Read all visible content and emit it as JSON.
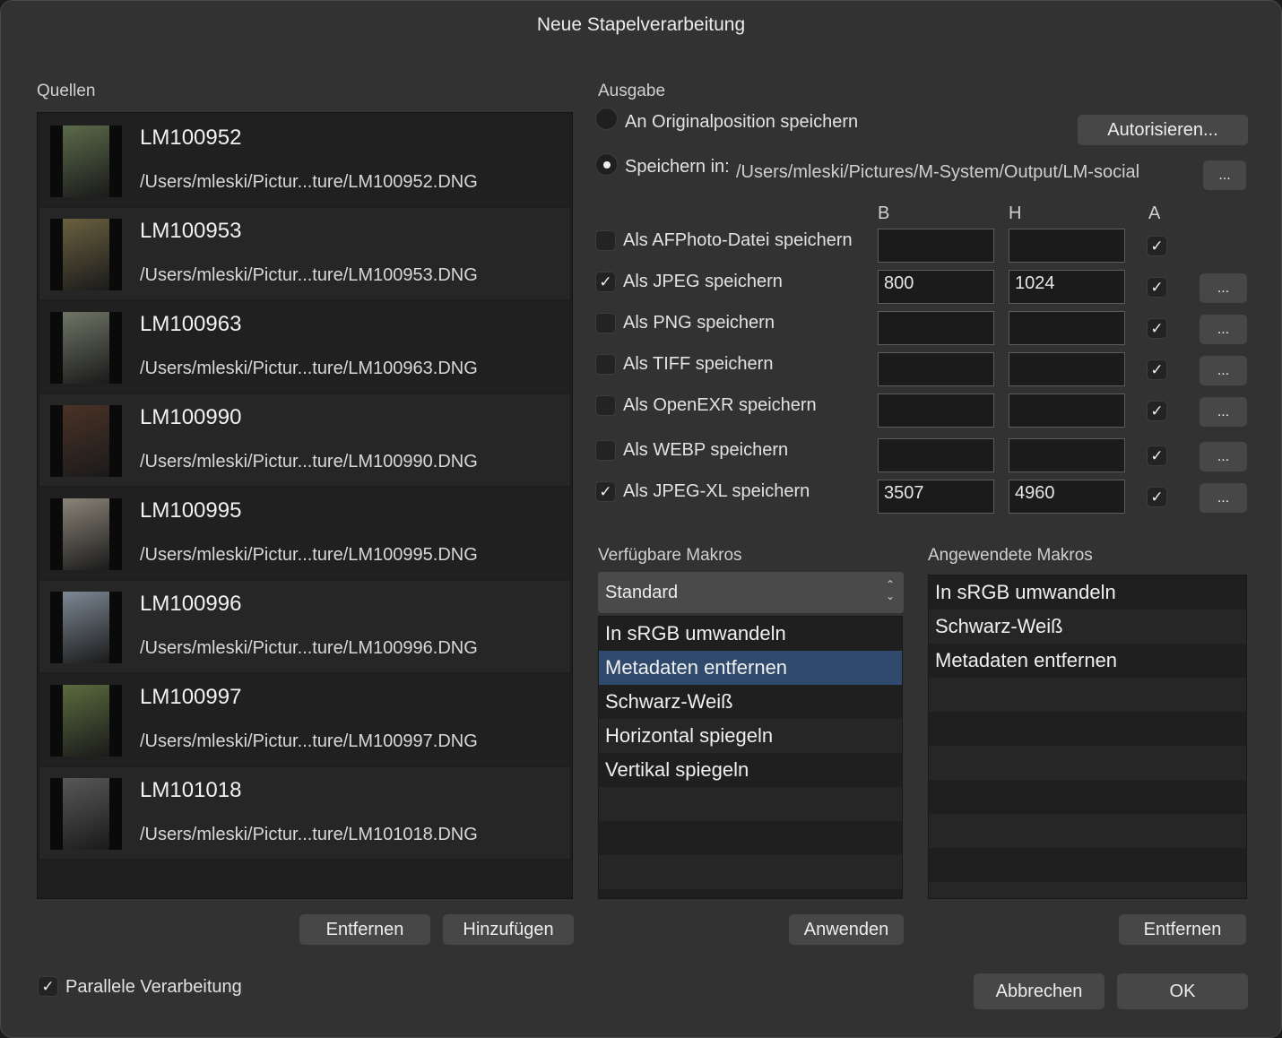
{
  "dialog": {
    "title": "Neue Stapelverarbeitung"
  },
  "sources": {
    "label": "Quellen",
    "items": [
      {
        "name": "LM100952",
        "path": "/Users/mleski/Pictur...ture/LM100952.DNG",
        "tone": "#5b6a4a"
      },
      {
        "name": "LM100953",
        "path": "/Users/mleski/Pictur...ture/LM100953.DNG",
        "tone": "#6a6040"
      },
      {
        "name": "LM100963",
        "path": "/Users/mleski/Pictur...ture/LM100963.DNG",
        "tone": "#6f7566"
      },
      {
        "name": "LM100990",
        "path": "/Users/mleski/Pictur...ture/LM100990.DNG",
        "tone": "#4a3226"
      },
      {
        "name": "LM100995",
        "path": "/Users/mleski/Pictur...ture/LM100995.DNG",
        "tone": "#8a8478"
      },
      {
        "name": "LM100996",
        "path": "/Users/mleski/Pictur...ture/LM100996.DNG",
        "tone": "#7d8894"
      },
      {
        "name": "LM100997",
        "path": "/Users/mleski/Pictur...ture/LM100997.DNG",
        "tone": "#5b6b3e"
      },
      {
        "name": "LM101018",
        "path": "/Users/mleski/Pictur...ture/LM101018.DNG",
        "tone": "#585858"
      }
    ],
    "remove_label": "Entfernen",
    "add_label": "Hinzufügen"
  },
  "output": {
    "label": "Ausgabe",
    "original_label": "An Originalposition speichern",
    "authorize_label": "Autorisieren...",
    "save_in_label": "Speichern in:",
    "save_path": "/Users/mleski/Pictures/M-System/Output/LM-social",
    "browse_label": "...",
    "col_b": "B",
    "col_h": "H",
    "col_a": "A",
    "formats": [
      {
        "label": "Als AFPhoto-Datei speichern",
        "checked": false,
        "b": "",
        "h": "",
        "a": true,
        "more": false
      },
      {
        "label": "Als JPEG speichern",
        "checked": true,
        "b": "800",
        "h": "1024",
        "a": true,
        "more": true
      },
      {
        "label": "Als PNG speichern",
        "checked": false,
        "b": "",
        "h": "",
        "a": true,
        "more": true
      },
      {
        "label": "Als TIFF speichern",
        "checked": false,
        "b": "",
        "h": "",
        "a": true,
        "more": true
      },
      {
        "label": "Als OpenEXR speichern",
        "checked": false,
        "b": "",
        "h": "",
        "a": true,
        "more": true
      },
      {
        "label": "Als WEBP speichern",
        "checked": false,
        "b": "",
        "h": "",
        "a": true,
        "more": true
      },
      {
        "label": "Als JPEG-XL speichern",
        "checked": true,
        "b": "3507",
        "h": "4960",
        "a": true,
        "more": true
      }
    ],
    "more_label": "..."
  },
  "available_macros": {
    "label": "Verfügbare Makros",
    "dropdown_value": "Standard",
    "items": [
      "In sRGB umwandeln",
      "Metadaten entfernen",
      "Schwarz-Weiß",
      "Horizontal spiegeln",
      "Vertikal spiegeln"
    ],
    "selected_index": 1,
    "apply_label": "Anwenden"
  },
  "applied_macros": {
    "label": "Angewendete Makros",
    "items": [
      "In sRGB umwandeln",
      "Schwarz-Weiß",
      "Metadaten entfernen"
    ],
    "remove_label": "Entfernen"
  },
  "footer": {
    "parallel_label": "Parallele Verarbeitung",
    "parallel_checked": true,
    "cancel_label": "Abbrechen",
    "ok_label": "OK"
  },
  "colors": {
    "window_bg": "#323232",
    "selection": "#2f4a6d",
    "button": "#474747"
  }
}
